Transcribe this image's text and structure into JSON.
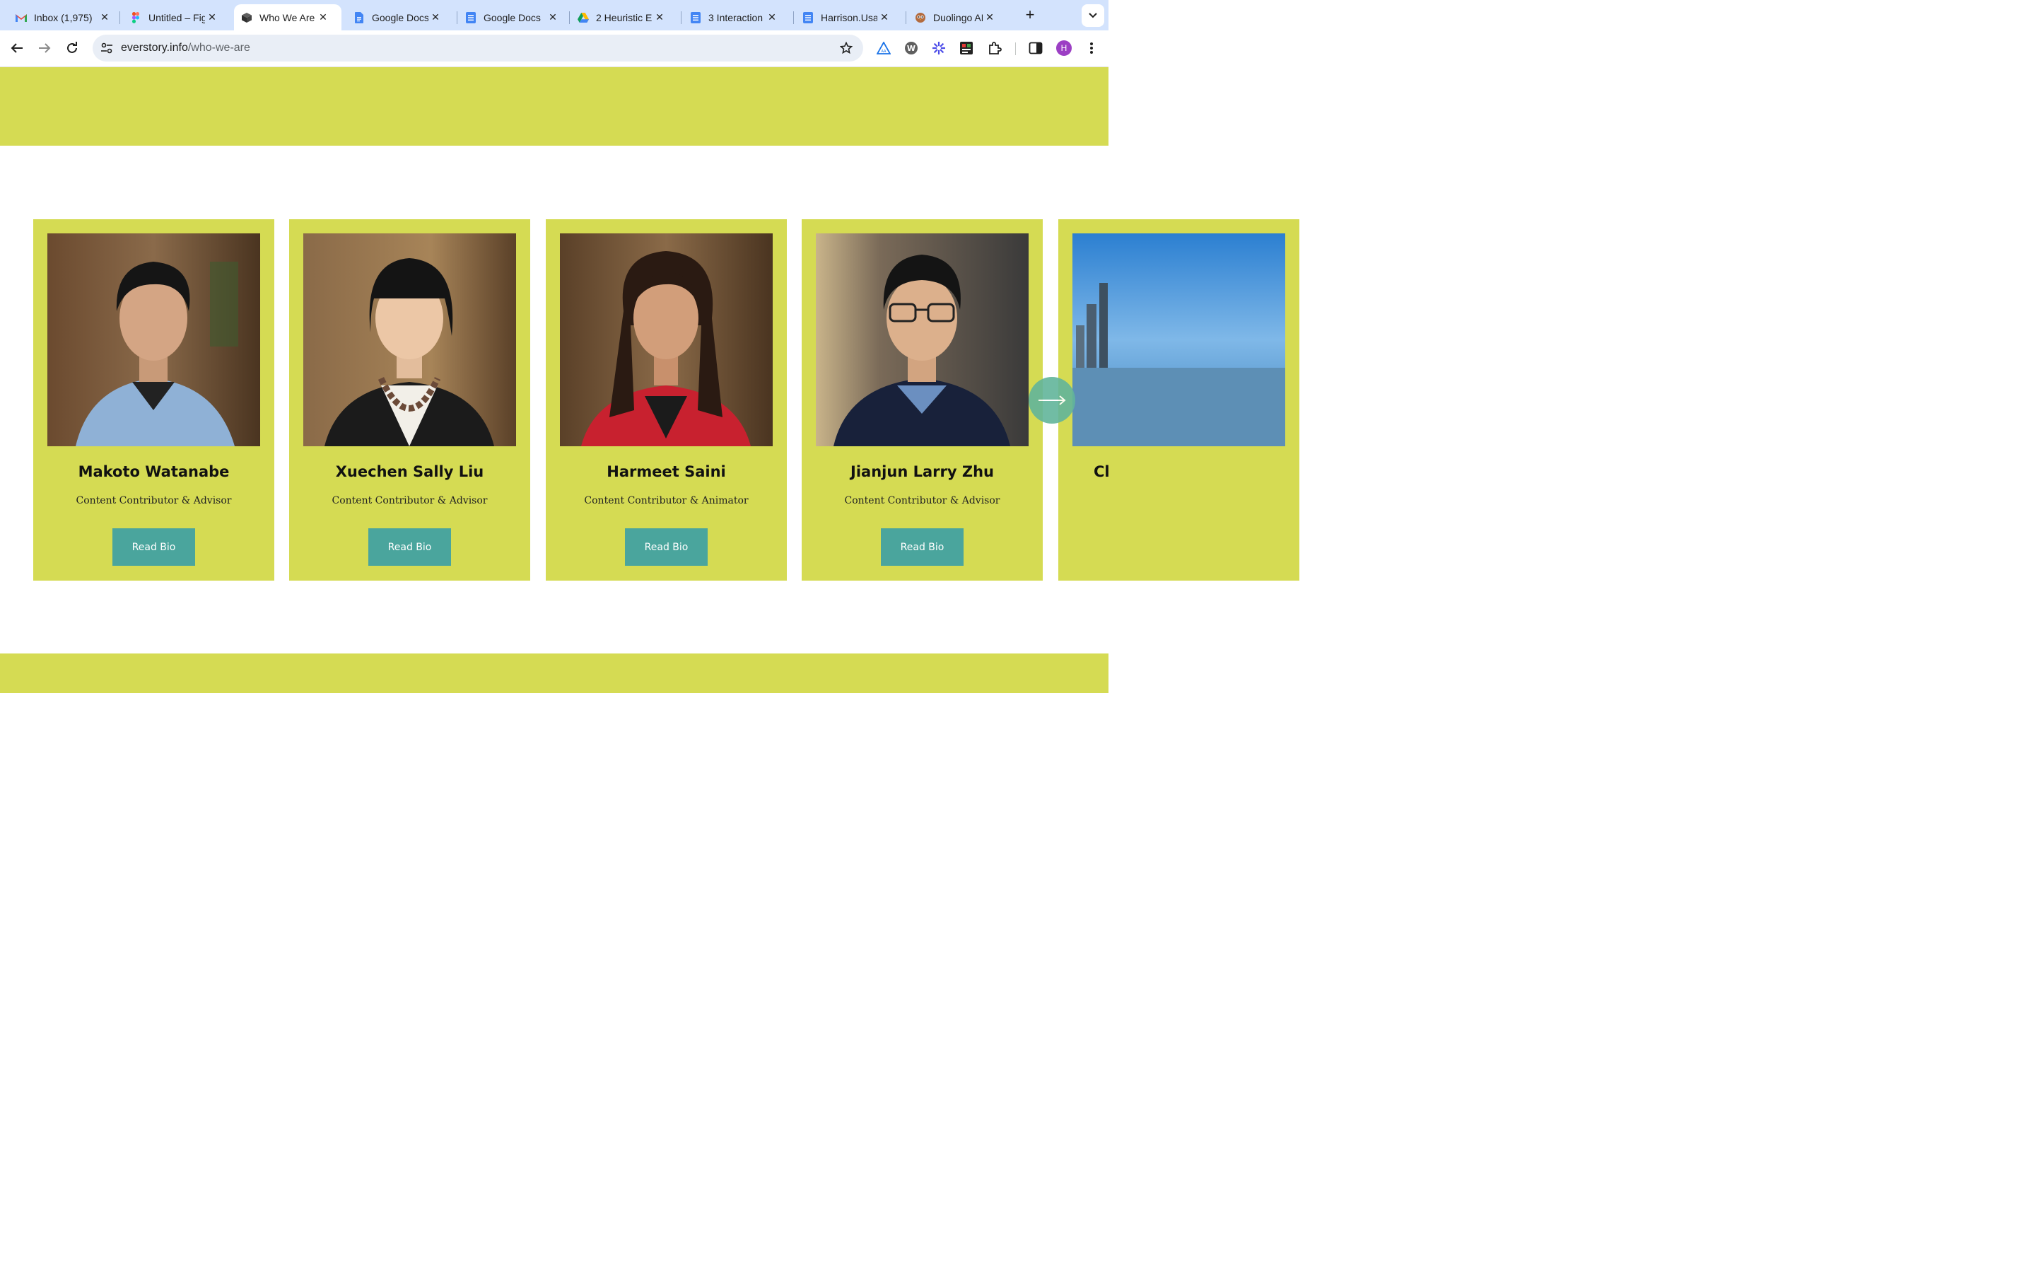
{
  "colors": {
    "brand_lime": "#d5db53",
    "button_teal": "#4aa59d",
    "arrow_teal": "#62b59b",
    "tabstrip_bg": "#d3e3fd"
  },
  "browser": {
    "tabs": [
      {
        "title": "Inbox (1,975)",
        "icon": "gmail-icon"
      },
      {
        "title": "Untitled – Figma",
        "icon": "figma-icon"
      },
      {
        "title": "Who We Are",
        "icon": "site-cube-icon"
      },
      {
        "title": "Google Docs",
        "icon": "google-docs-icon"
      },
      {
        "title": "Google Docs",
        "icon": "google-docs-icon"
      },
      {
        "title": "2 Heuristic E",
        "icon": "google-drive-icon"
      },
      {
        "title": "3 Interaction",
        "icon": "google-docs-icon"
      },
      {
        "title": "Harrison.Usa",
        "icon": "google-docs-icon"
      },
      {
        "title": "Duolingo AB",
        "icon": "duolingo-icon"
      }
    ],
    "active_tab": 2,
    "url_domain": "everstory.info",
    "url_path": "/who-we-are",
    "profile_initial": "H"
  },
  "team": {
    "members": [
      {
        "name": "Makoto Watanabe",
        "role": "Content Contributor & Advisor",
        "button": "Read Bio"
      },
      {
        "name": "Xuechen Sally Liu",
        "role": "Content Contributor & Advisor",
        "button": "Read Bio"
      },
      {
        "name": "Harmeet Saini",
        "role": "Content Contributor & Animator",
        "button": "Read Bio"
      },
      {
        "name": "Jianjun Larry Zhu",
        "role": "Content Contributor & Advisor",
        "button": "Read Bio"
      },
      {
        "name": "Cl",
        "role": "",
        "button": ""
      }
    ]
  }
}
